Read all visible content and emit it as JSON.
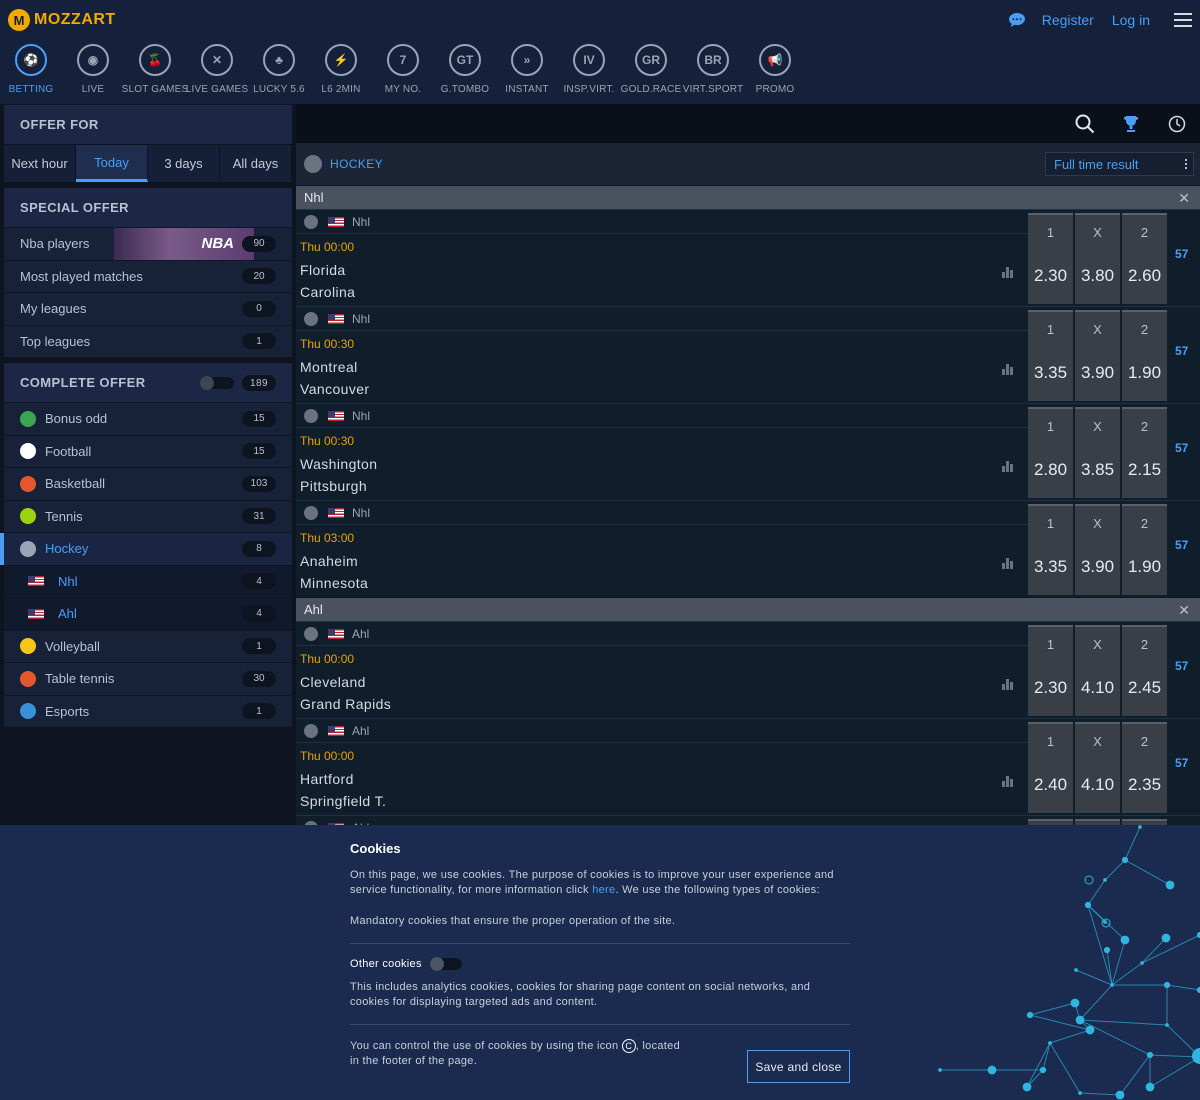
{
  "header": {
    "logo": "MOZZART",
    "register": "Register",
    "login": "Log in"
  },
  "nav": [
    {
      "label": "BETTING",
      "icon": "soccer-ball-icon",
      "glyph": "⚽",
      "active": true
    },
    {
      "label": "LIVE",
      "icon": "broadcast-icon",
      "glyph": "◉"
    },
    {
      "label": "SLOT GAMES",
      "icon": "cherries-icon",
      "glyph": "🍒"
    },
    {
      "label": "LIVE GAMES",
      "icon": "cards-icon",
      "glyph": "✕"
    },
    {
      "label": "LUCKY 5.6",
      "icon": "clover-icon",
      "glyph": "♣"
    },
    {
      "label": "L6 2MIN",
      "icon": "lightning-icon",
      "glyph": "⚡"
    },
    {
      "label": "MY NO.",
      "icon": "seven-icon",
      "glyph": "7"
    },
    {
      "label": "G.TOMBO",
      "icon": "gt-icon",
      "glyph": "GT"
    },
    {
      "label": "INSTANT",
      "icon": "double-chevron-icon",
      "glyph": "»"
    },
    {
      "label": "INSP.VIRT.",
      "icon": "iv-icon",
      "glyph": "IV"
    },
    {
      "label": "GOLD.RACE",
      "icon": "gr-icon",
      "glyph": "GR"
    },
    {
      "label": "VIRT.SPORT",
      "icon": "br-icon",
      "glyph": "BR"
    },
    {
      "label": "PROMO",
      "icon": "megaphone-icon",
      "glyph": "📢"
    }
  ],
  "sidebar": {
    "offer_for": "OFFER FOR",
    "periods": [
      "Next hour",
      "Today",
      "3 days",
      "All days"
    ],
    "special_offer": "SPECIAL OFFER",
    "nba_banner": "NBA",
    "special_items": [
      {
        "label": "Nba players",
        "count": "90"
      },
      {
        "label": "Most played matches",
        "count": "20"
      },
      {
        "label": "My leagues",
        "count": "0"
      },
      {
        "label": "Top leagues",
        "count": "1"
      }
    ],
    "complete_offer": "COMPLETE OFFER",
    "complete_count": "189",
    "sports": [
      {
        "label": "Bonus odd",
        "count": "15",
        "color": "#3aa655"
      },
      {
        "label": "Football",
        "count": "15",
        "color": "#ffffff"
      },
      {
        "label": "Basketball",
        "count": "103",
        "color": "#e4572e"
      },
      {
        "label": "Tennis",
        "count": "31",
        "color": "#9ad40f"
      },
      {
        "label": "Hockey",
        "count": "8",
        "color": "#9aa4b4"
      },
      {
        "label": "Nhl",
        "count": "4",
        "sub": true
      },
      {
        "label": "Ahl",
        "count": "4",
        "sub": true
      },
      {
        "label": "Volleyball",
        "count": "1",
        "color": "#f5c518"
      },
      {
        "label": "Table tennis",
        "count": "30",
        "color": "#e4572e"
      },
      {
        "label": "Esports",
        "count": "1",
        "color": "#3b8fd9"
      }
    ]
  },
  "main": {
    "sport": "HOCKEY",
    "market": "Full time result",
    "more": "57",
    "odd_labels": [
      "1",
      "X",
      "2"
    ],
    "leagues": [
      {
        "name": "Nhl",
        "matches": [
          {
            "league": "Nhl",
            "time": "Thu 00:00",
            "home": "Florida",
            "away": "Carolina",
            "odds": [
              "2.30",
              "3.80",
              "2.60"
            ]
          },
          {
            "league": "Nhl",
            "time": "Thu 00:30",
            "home": "Montreal",
            "away": "Vancouver",
            "odds": [
              "3.35",
              "3.90",
              "1.90"
            ]
          },
          {
            "league": "Nhl",
            "time": "Thu 00:30",
            "home": "Washington",
            "away": "Pittsburgh",
            "odds": [
              "2.80",
              "3.85",
              "2.15"
            ]
          },
          {
            "league": "Nhl",
            "time": "Thu 03:00",
            "home": "Anaheim",
            "away": "Minnesota",
            "odds": [
              "3.35",
              "3.90",
              "1.90"
            ]
          }
        ]
      },
      {
        "name": "Ahl",
        "matches": [
          {
            "league": "Ahl",
            "time": "Thu 00:00",
            "home": "Cleveland",
            "away": "Grand Rapids",
            "odds": [
              "2.30",
              "4.10",
              "2.45"
            ]
          },
          {
            "league": "Ahl",
            "time": "Thu 00:00",
            "home": "Hartford",
            "away": "Springfield T.",
            "odds": [
              "2.40",
              "4.10",
              "2.35"
            ]
          },
          {
            "league": "Ahl",
            "time": "",
            "home": "",
            "away": "",
            "odds": [
              "",
              "",
              ""
            ]
          }
        ]
      }
    ]
  },
  "cookies": {
    "title": "Cookies",
    "intro": "On this page, we use cookies. The purpose of cookies is to improve your user experience and service functionality, for more information click ",
    "link": "here",
    "intro_end": ". We use the following types of cookies:",
    "mandatory": "Mandatory cookies that ensure the proper operation of the site.",
    "other": "Other cookies",
    "other_desc": "This includes analytics cookies, cookies for sharing page content on social networks, and cookies for displaying targeted ads and content.",
    "control": "You can control the use of cookies by using the icon",
    "control_end": ", located in the footer of the page.",
    "save": "Save and close"
  }
}
